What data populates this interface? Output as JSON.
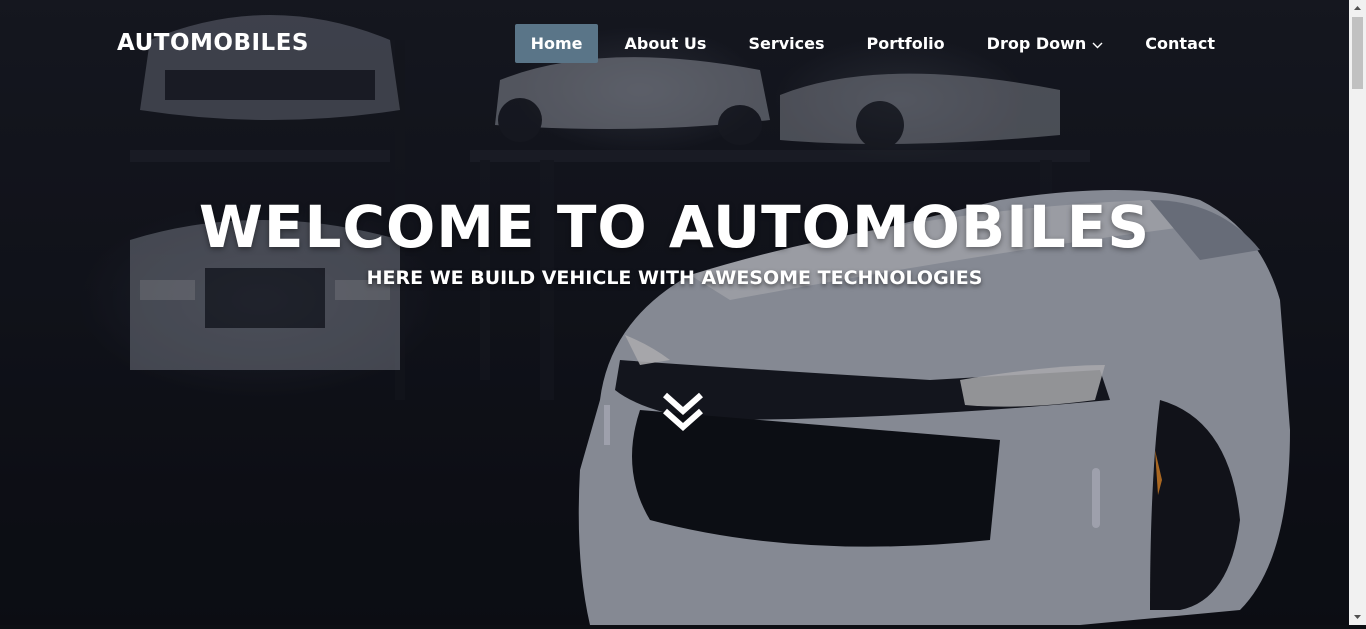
{
  "brand": {
    "name": "AUTOMOBILES"
  },
  "nav": {
    "items": [
      {
        "label": "Home",
        "active": true
      },
      {
        "label": "About Us"
      },
      {
        "label": "Services"
      },
      {
        "label": "Portfolio"
      },
      {
        "label": "Drop Down",
        "icon": "chevron-down-icon"
      },
      {
        "label": "Contact"
      }
    ]
  },
  "hero": {
    "title": "WELCOME TO AUTOMOBILES",
    "subtitle": "HERE WE BUILD VEHICLE WITH AWESOME TECHNOLOGIES",
    "scroll_icon": "double-chevron-down-icon"
  },
  "colors": {
    "nav_active_bg": "#5a7588",
    "text": "#ffffff"
  }
}
